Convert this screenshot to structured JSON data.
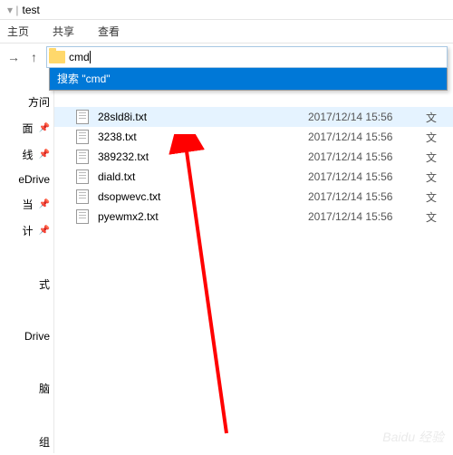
{
  "window": {
    "title": "test"
  },
  "ribbon": {
    "tab1": "主页",
    "tab2": "共享",
    "tab3": "查看"
  },
  "address": {
    "value": "cmd"
  },
  "dropdown": {
    "item1": "cmd",
    "item2": "搜索 \"cmd\""
  },
  "sidebar": {
    "items": [
      "方问",
      "面",
      "线",
      "eDrive",
      "当",
      "计"
    ],
    "lower": [
      "式",
      "Drive",
      "脑",
      "组"
    ]
  },
  "files": [
    {
      "name": "28sld8i.txt",
      "date": "2017/12/14 15:56",
      "type": "文"
    },
    {
      "name": "3238.txt",
      "date": "2017/12/14 15:56",
      "type": "文"
    },
    {
      "name": "389232.txt",
      "date": "2017/12/14 15:56",
      "type": "文"
    },
    {
      "name": "diald.txt",
      "date": "2017/12/14 15:56",
      "type": "文"
    },
    {
      "name": "dsopwevc.txt",
      "date": "2017/12/14 15:56",
      "type": "文"
    },
    {
      "name": "pyewmx2.txt",
      "date": "2017/12/14 15:56",
      "type": "文"
    }
  ],
  "watermark": "Baidu 经验"
}
